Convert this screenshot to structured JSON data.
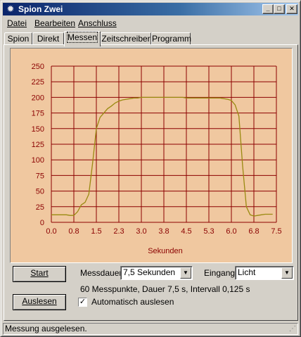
{
  "window": {
    "title": "Spion Zwei",
    "icon": "gear-icon",
    "minimize_glyph": "_",
    "maximize_glyph": "□",
    "close_glyph": "✕"
  },
  "menu": [
    {
      "label": "Datei"
    },
    {
      "label": "Bearbeiten"
    },
    {
      "label": "Anschluss"
    }
  ],
  "tabs": [
    {
      "label": "Spion"
    },
    {
      "label": "Direkt"
    },
    {
      "label": "Messen",
      "active": true
    },
    {
      "label": "Zeitschreiber"
    },
    {
      "label": "Programm"
    }
  ],
  "chart_data": {
    "type": "line",
    "xlabel": "Sekunden",
    "ylabel": "",
    "x_ticks": [
      "0.0",
      "0.8",
      "1.5",
      "2.3",
      "3.0",
      "3.8",
      "4.5",
      "5.3",
      "6.0",
      "6.8",
      "7.5"
    ],
    "y_ticks": [
      "0",
      "25",
      "50",
      "75",
      "100",
      "125",
      "150",
      "175",
      "200",
      "225",
      "250"
    ],
    "xlim": [
      0,
      7.5
    ],
    "ylim": [
      0,
      250
    ],
    "grid": true,
    "background": "#f0c8a0",
    "grid_color": "#8b0000",
    "line_color": "#9a8a10",
    "series": [
      {
        "x": [
          0.0,
          0.125,
          0.25,
          0.375,
          0.5,
          0.625,
          0.75,
          0.875,
          1.0,
          1.125,
          1.25,
          1.375,
          1.5,
          1.625,
          1.75,
          1.875,
          2.0,
          2.125,
          2.25,
          2.375,
          2.5,
          2.625,
          2.75,
          2.875,
          3.0,
          3.125,
          3.25,
          3.375,
          3.5,
          3.625,
          3.75,
          3.875,
          4.0,
          4.125,
          4.25,
          4.375,
          4.5,
          4.625,
          4.75,
          4.875,
          5.0,
          5.125,
          5.25,
          5.375,
          5.5,
          5.625,
          5.75,
          5.875,
          6.0,
          6.125,
          6.25,
          6.375,
          6.5,
          6.625,
          6.75,
          6.875,
          7.0,
          7.125,
          7.25,
          7.375
        ],
        "values": [
          12,
          12,
          12,
          12,
          12,
          11,
          11,
          17,
          28,
          32,
          45,
          95,
          150,
          168,
          175,
          182,
          186,
          191,
          194,
          196,
          197,
          198,
          199,
          199,
          200,
          200,
          200,
          200,
          200,
          200,
          200,
          200,
          200,
          200,
          200,
          200,
          199,
          199,
          199,
          199,
          199,
          199,
          199,
          199,
          199,
          199,
          198,
          197,
          195,
          188,
          170,
          90,
          25,
          12,
          10,
          11,
          12,
          13,
          13,
          13
        ]
      }
    ]
  },
  "controls": {
    "start_label": "Start",
    "auslesen_label": "Auslesen",
    "messdauer_label": "Messdauer:",
    "messdauer_value": "7,5 Sekunden",
    "eingang_label": "Eingang:",
    "eingang_value": "Licht",
    "info_text": "60 Messpunkte, Dauer 7,5 s, Intervall 0,125 s",
    "auto_label": "Automatisch auslesen",
    "auto_checked": true,
    "dropdown_glyph": "▼",
    "check_glyph": "✓"
  },
  "status": {
    "text": "Messung ausgelesen."
  }
}
